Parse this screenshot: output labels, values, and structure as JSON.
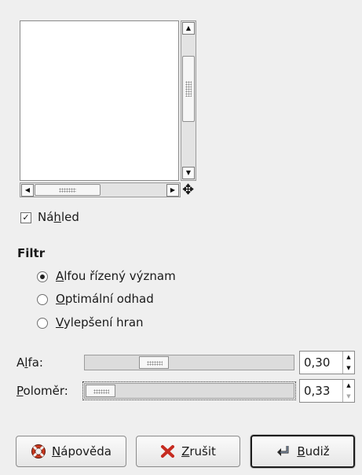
{
  "preview": {
    "checkbox_checked": true,
    "checkbox_label_pre": "Ná",
    "checkbox_label_mnemonic": "h",
    "checkbox_label_post": "led"
  },
  "filter": {
    "heading": "Filtr",
    "options": [
      {
        "mnemonic": "A",
        "rest": "lfou řízený význam",
        "selected": true
      },
      {
        "mnemonic": "O",
        "rest": "ptimální odhad",
        "selected": false
      },
      {
        "mnemonic": "V",
        "rest": "ylepšení hran",
        "selected": false
      }
    ]
  },
  "params": {
    "alpha": {
      "label_pre": "A",
      "label_mnemonic": "l",
      "label_post": "fa:",
      "value": "0,30",
      "fraction": 0.3
    },
    "radius": {
      "label_pre": "",
      "label_mnemonic": "P",
      "label_post": "oloměr:",
      "value": "0,33",
      "fraction": 0.0
    }
  },
  "buttons": {
    "help": {
      "mnemonic": "N",
      "rest": "ápověda",
      "icon": "lifebuoy-icon"
    },
    "cancel": {
      "mnemonic": "Z",
      "rest": "rušit",
      "icon": "cross-icon"
    },
    "ok": {
      "mnemonic": "B",
      "rest": "udiž",
      "icon": "return-arrow-icon"
    }
  },
  "colors": {
    "background": "#efefef",
    "cancel_icon": "#c62b20",
    "help_icon": "#c8371e"
  }
}
